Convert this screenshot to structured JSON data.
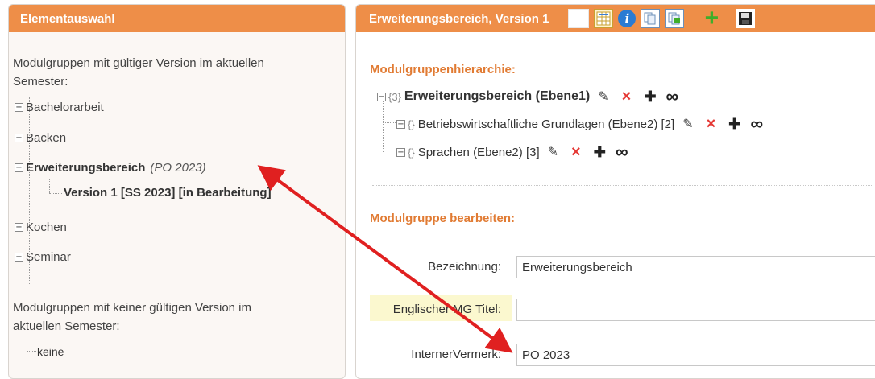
{
  "left": {
    "header": "Elementauswahl",
    "valid_label_line1": "Modulgruppen mit gültiger Version im aktuellen",
    "valid_label_line2": "Semester:",
    "tree": [
      {
        "label": "Bachelorarbeit"
      },
      {
        "label": "Backen"
      },
      {
        "label": "Erweiterungsbereich",
        "note": "(PO 2023)",
        "child": "Version 1 [SS 2023] [in Bearbeitung]"
      },
      {
        "label": "Kochen"
      },
      {
        "label": "Seminar"
      }
    ],
    "invalid_label_line1": "Modulgruppen mit keiner gültigen Version im",
    "invalid_label_line2": "aktuellen Semester:",
    "none_label": "keine"
  },
  "right": {
    "header": "Erweiterungsbereich, Version 1",
    "toolbar_icons": [
      "blank-icon",
      "grid-icon",
      "info-icon",
      "copy-icon",
      "copy-add-icon",
      "add-icon",
      "save-icon"
    ],
    "hierarchy": {
      "title": "Modulgruppenhierarchie:",
      "root": {
        "prefix": "{3}",
        "label": "Erweiterungsbereich (Ebene1)"
      },
      "children": [
        {
          "prefix": "{}",
          "label": "Betriebswirtschaftliche Grundlagen (Ebene2) [2]"
        },
        {
          "prefix": "{}",
          "label": "Sprachen (Ebene2) [3]"
        }
      ]
    },
    "edit": {
      "title": "Modulgruppe bearbeiten:",
      "fields": {
        "bezeichnung": {
          "label": "Bezeichnung:",
          "value": "Erweiterungsbereich"
        },
        "englisch": {
          "label": "Englischer MG Titel:",
          "value": ""
        },
        "vermerk": {
          "label": "InternerVermerk:",
          "value": "PO 2023"
        }
      }
    }
  },
  "colors": {
    "header_orange": "#ee8e48",
    "section_orange": "#e17b33",
    "arrow_red": "#e02020",
    "highlight_yellow": "#fbf8cf"
  }
}
